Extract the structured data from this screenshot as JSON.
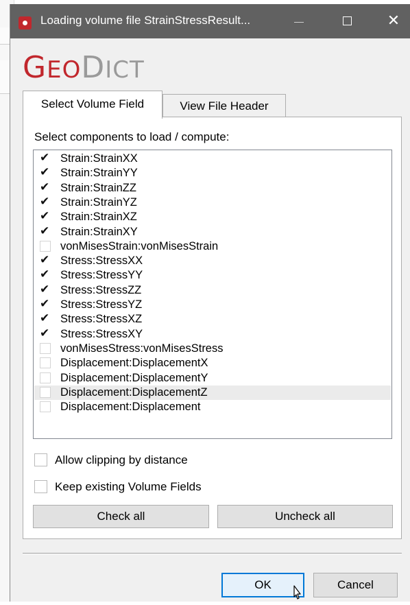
{
  "window": {
    "title": "Loading volume file StrainStressResult...",
    "minimize_glyph": "",
    "maximize_glyph": "",
    "close_glyph": "✕"
  },
  "logo": {
    "part1_big": "G",
    "part1_small": "EO",
    "part2_big": "D",
    "part2_small": "ICT"
  },
  "tabs": [
    {
      "label": "Select Volume Field",
      "active": true
    },
    {
      "label": "View File Header",
      "active": false
    }
  ],
  "panel": {
    "prompt": "Select components to load / compute:",
    "components": [
      {
        "label": "Strain:StrainXX",
        "checked": true
      },
      {
        "label": "Strain:StrainYY",
        "checked": true
      },
      {
        "label": "Strain:StrainZZ",
        "checked": true
      },
      {
        "label": "Strain:StrainYZ",
        "checked": true
      },
      {
        "label": "Strain:StrainXZ",
        "checked": true
      },
      {
        "label": "Strain:StrainXY",
        "checked": true
      },
      {
        "label": "vonMisesStrain:vonMisesStrain",
        "checked": false
      },
      {
        "label": "Stress:StressXX",
        "checked": true
      },
      {
        "label": "Stress:StressYY",
        "checked": true
      },
      {
        "label": "Stress:StressZZ",
        "checked": true
      },
      {
        "label": "Stress:StressYZ",
        "checked": true
      },
      {
        "label": "Stress:StressXZ",
        "checked": true
      },
      {
        "label": "Stress:StressXY",
        "checked": true
      },
      {
        "label": "vonMisesStress:vonMisesStress",
        "checked": false
      },
      {
        "label": "Displacement:DisplacementX",
        "checked": false
      },
      {
        "label": "Displacement:DisplacementY",
        "checked": false
      },
      {
        "label": "Displacement:DisplacementZ",
        "checked": false,
        "highlighted": true
      },
      {
        "label": "Displacement:Displacement",
        "checked": false
      }
    ],
    "allow_clipping_label": "Allow clipping by distance",
    "keep_existing_label": "Keep existing Volume Fields",
    "check_all_label": "Check all",
    "uncheck_all_label": "Uncheck all"
  },
  "footer": {
    "ok_label": "OK",
    "cancel_label": "Cancel"
  },
  "colors": {
    "brand_red": "#c1272d",
    "titlebar": "#616161",
    "ok_border": "#0078d7"
  }
}
